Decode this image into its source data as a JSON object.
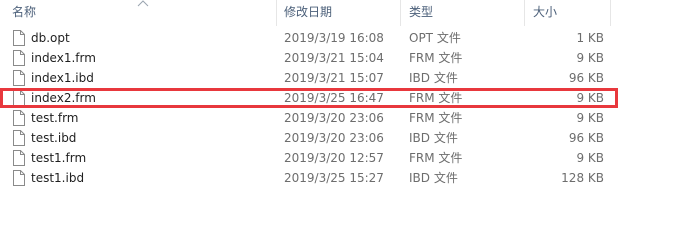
{
  "columns": {
    "name": "名称",
    "date": "修改日期",
    "type": "类型",
    "size": "大小"
  },
  "files": [
    {
      "name": "db.opt",
      "date": "2019/3/19 16:08",
      "type": "OPT 文件",
      "size": "1 KB"
    },
    {
      "name": "index1.frm",
      "date": "2019/3/21 15:04",
      "type": "FRM 文件",
      "size": "9 KB"
    },
    {
      "name": "index1.ibd",
      "date": "2019/3/21 15:07",
      "type": "IBD 文件",
      "size": "96 KB"
    },
    {
      "name": "index2.frm",
      "date": "2019/3/25 16:47",
      "type": "FRM 文件",
      "size": "9 KB",
      "highlighted": true
    },
    {
      "name": "test.frm",
      "date": "2019/3/20 23:06",
      "type": "FRM 文件",
      "size": "9 KB"
    },
    {
      "name": "test.ibd",
      "date": "2019/3/20 23:06",
      "type": "IBD 文件",
      "size": "96 KB"
    },
    {
      "name": "test1.frm",
      "date": "2019/3/20 12:57",
      "type": "FRM 文件",
      "size": "9 KB"
    },
    {
      "name": "test1.ibd",
      "date": "2019/3/25 15:27",
      "type": "IBD 文件",
      "size": "128 KB"
    }
  ],
  "colors": {
    "highlight": "#e8383d",
    "header_text": "#4c607a",
    "secondary_text": "#6d6d6d"
  },
  "icons": {
    "file": "blank-document-icon",
    "sort": "sort-ascending-icon"
  }
}
